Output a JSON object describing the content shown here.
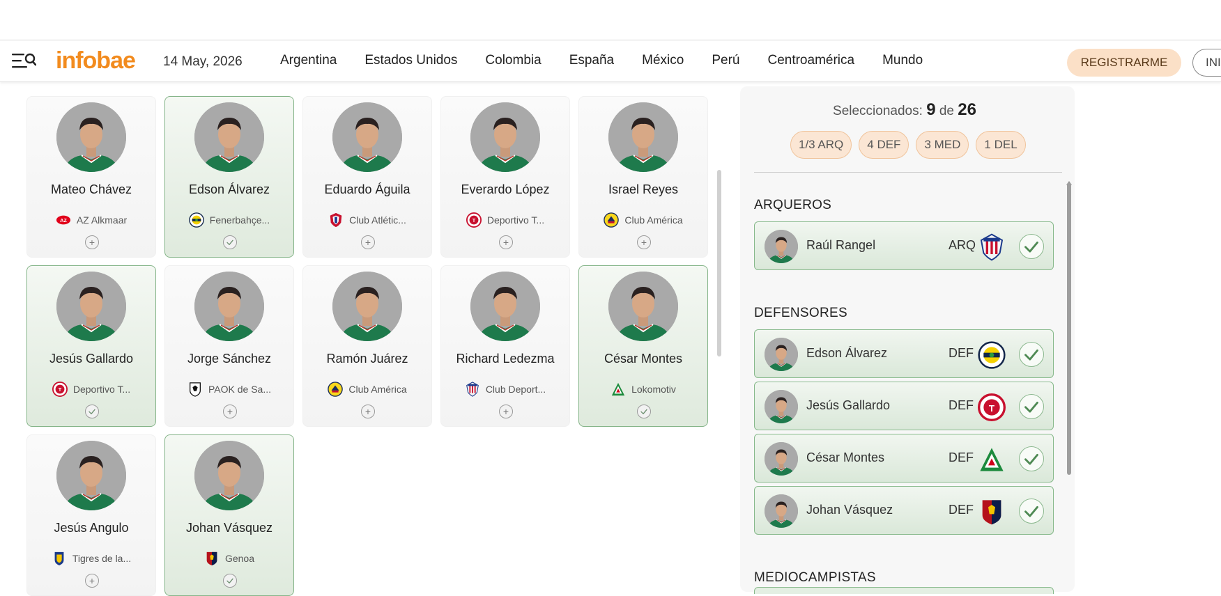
{
  "header": {
    "logo": "infobae",
    "date": "14 May, 2026",
    "nav": [
      "Argentina",
      "Estados Unidos",
      "Colombia",
      "España",
      "México",
      "Perú",
      "Centroamérica",
      "Mundo"
    ],
    "register_label": "REGISTRARME",
    "login_label": "INI"
  },
  "colors": {
    "brand_orange": "#f28b1e",
    "register_bg": "#fbe0c7",
    "selected_green": "#84b488",
    "mexico_green": "#1e7a4c"
  },
  "players": [
    {
      "name": "Mateo Chávez",
      "club": "AZ Alkmaar",
      "selected": false,
      "club_icon": "az-alkmaar-logo"
    },
    {
      "name": "Edson Álvarez",
      "club": "Fenerbahçe...",
      "selected": true,
      "club_icon": "fenerbahce-logo"
    },
    {
      "name": "Eduardo Águila",
      "club": "Club Atlétic...",
      "selected": false,
      "club_icon": "atletico-san-luis-logo"
    },
    {
      "name": "Everardo López",
      "club": "Deportivo T...",
      "selected": false,
      "club_icon": "toluca-logo"
    },
    {
      "name": "Israel Reyes",
      "club": "Club América",
      "selected": false,
      "club_icon": "america-logo"
    },
    {
      "name": "Jesús Gallardo",
      "club": "Deportivo T...",
      "selected": true,
      "club_icon": "toluca-logo"
    },
    {
      "name": "Jorge Sánchez",
      "club": "PAOK de Sa...",
      "selected": false,
      "club_icon": "paok-logo"
    },
    {
      "name": "Ramón Juárez",
      "club": "Club América",
      "selected": false,
      "club_icon": "america-logo"
    },
    {
      "name": "Richard Ledezma",
      "club": "Club Deport...",
      "selected": false,
      "club_icon": "chivas-logo"
    },
    {
      "name": "César Montes",
      "club": "Lokomotiv",
      "selected": true,
      "club_icon": "lokomotiv-logo"
    },
    {
      "name": "Jesús Angulo",
      "club": "Tigres de la...",
      "selected": false,
      "club_icon": "tigres-logo"
    },
    {
      "name": "Johan Vásquez",
      "club": "Genoa",
      "selected": true,
      "club_icon": "genoa-logo"
    }
  ],
  "panel": {
    "selected_label": "Seleccionados:",
    "selected_count": "9",
    "of_label": "de",
    "total": "26",
    "pills": [
      "1/3 ARQ",
      "4 DEF",
      "3 MED",
      "1 DEL"
    ],
    "sections": [
      {
        "title": "ARQUEROS",
        "players": [
          {
            "name": "Raúl Rangel",
            "pos": "ARQ",
            "club_icon": "chivas-logo"
          }
        ]
      },
      {
        "title": "DEFENSORES",
        "players": [
          {
            "name": "Edson Álvarez",
            "pos": "DEF",
            "club_icon": "fenerbahce-logo"
          },
          {
            "name": "Jesús Gallardo",
            "pos": "DEF",
            "club_icon": "toluca-logo"
          },
          {
            "name": "César Montes",
            "pos": "DEF",
            "club_icon": "lokomotiv-logo"
          },
          {
            "name": "Johan Vásquez",
            "pos": "DEF",
            "club_icon": "genoa-logo"
          }
        ]
      },
      {
        "title": "MEDIOCAMPISTAS",
        "players": []
      }
    ]
  }
}
